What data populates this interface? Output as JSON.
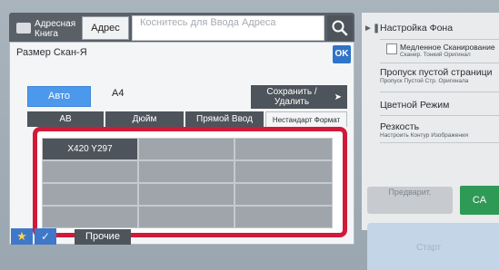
{
  "header": {
    "address_book_label": "Адресная Книга",
    "address_button_label": "Адрес",
    "address_input_placeholder": "Коснитесь для Ввода Адреса"
  },
  "dialog": {
    "title": "Размер Скан-Я",
    "ok_label": "OK",
    "auto_label": "Авто",
    "current_size": "A4",
    "save_delete_label": "Сохранить /Удалить",
    "tabs": [
      {
        "label": "AB",
        "active": false
      },
      {
        "label": "Дюйм",
        "active": false
      },
      {
        "label": "Прямой Ввод",
        "active": false
      },
      {
        "label": "Нестандарт Формат",
        "active": true
      }
    ],
    "custom_sizes": [
      [
        "X420 Y297",
        "",
        ""
      ],
      [
        "",
        "",
        ""
      ],
      [
        "",
        "",
        ""
      ],
      [
        "",
        "",
        ""
      ]
    ]
  },
  "right_panel": {
    "items": [
      {
        "title": "Настройка Фона",
        "subtitle": ""
      },
      {
        "title": "Медленное Сканирование",
        "subtitle": "Сканир. Тонкий Оригинал",
        "checkbox": true
      },
      {
        "title": "Пропуск пустой страници",
        "subtitle": "Пропуск Пустой Стр. Оригинала"
      },
      {
        "title": "Цветной Режим",
        "subtitle": ""
      },
      {
        "title": "Резкость",
        "subtitle": "Настроить Контур Изображения"
      }
    ],
    "preview_label": "Предварит.",
    "ca_label": "CA",
    "start_label": "Старт"
  },
  "bottom_bar": {
    "other_label": "Прочие"
  },
  "colors": {
    "accent_blue": "#4b98ec",
    "highlight_red": "#d11a3a",
    "ca_green": "#2f9a55",
    "dark_button": "#4e545b"
  }
}
